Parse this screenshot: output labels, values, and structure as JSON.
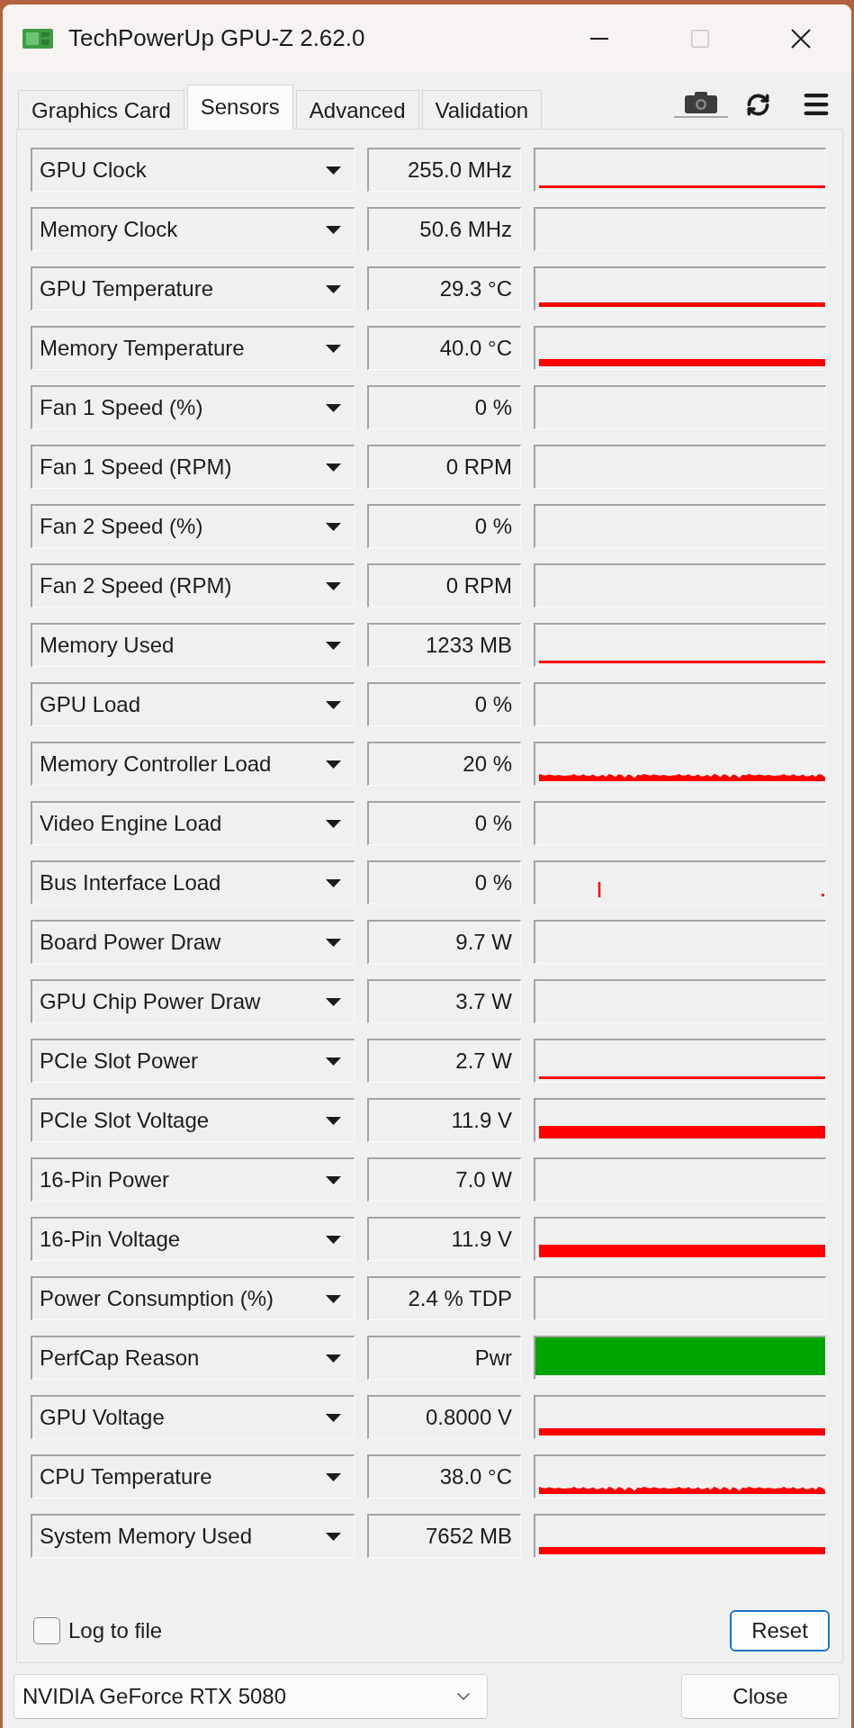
{
  "window": {
    "title": "TechPowerUp GPU-Z 2.62.0",
    "maximize_disabled": true
  },
  "tabs": [
    {
      "label": "Graphics Card",
      "selected": false
    },
    {
      "label": "Sensors",
      "selected": true
    },
    {
      "label": "Advanced",
      "selected": false
    },
    {
      "label": "Validation",
      "selected": false
    }
  ],
  "sensors": [
    {
      "name": "GPU Clock",
      "value": "255.0 MHz",
      "kind": "thin"
    },
    {
      "name": "Memory Clock",
      "value": "50.6 MHz",
      "kind": "none"
    },
    {
      "name": "GPU Temperature",
      "value": "29.3 °C",
      "kind": "line"
    },
    {
      "name": "Memory Temperature",
      "value": "40.0 °C",
      "kind": "thick"
    },
    {
      "name": "Fan 1 Speed (%)",
      "value": "0 %",
      "kind": "none"
    },
    {
      "name": "Fan 1 Speed (RPM)",
      "value": "0 RPM",
      "kind": "none"
    },
    {
      "name": "Fan 2 Speed (%)",
      "value": "0 %",
      "kind": "none"
    },
    {
      "name": "Fan 2 Speed (RPM)",
      "value": "0 RPM",
      "kind": "none"
    },
    {
      "name": "Memory Used",
      "value": "1233 MB",
      "kind": "thin"
    },
    {
      "name": "GPU Load",
      "value": "0 %",
      "kind": "none"
    },
    {
      "name": "Memory Controller Load",
      "value": "20 %",
      "kind": "noise"
    },
    {
      "name": "Video Engine Load",
      "value": "0 %",
      "kind": "none"
    },
    {
      "name": "Bus Interface Load",
      "value": "0 %",
      "kind": "spike"
    },
    {
      "name": "Board Power Draw",
      "value": "9.7 W",
      "kind": "none"
    },
    {
      "name": "GPU Chip Power Draw",
      "value": "3.7 W",
      "kind": "none"
    },
    {
      "name": "PCIe Slot Power",
      "value": "2.7 W",
      "kind": "thin"
    },
    {
      "name": "PCIe Slot Voltage",
      "value": "11.9 V",
      "kind": "heavy"
    },
    {
      "name": "16-Pin Power",
      "value": "7.0 W",
      "kind": "none"
    },
    {
      "name": "16-Pin Voltage",
      "value": "11.9 V",
      "kind": "heavy"
    },
    {
      "name": "Power Consumption (%)",
      "value": "2.4 % TDP",
      "kind": "none"
    },
    {
      "name": "PerfCap Reason",
      "value": "Pwr",
      "kind": "fill"
    },
    {
      "name": "GPU Voltage",
      "value": "0.8000 V",
      "kind": "thick"
    },
    {
      "name": "CPU Temperature",
      "value": "38.0 °C",
      "kind": "noise"
    },
    {
      "name": "System Memory Used",
      "value": "7652 MB",
      "kind": "thick"
    }
  ],
  "log_to_file": {
    "label": "Log to file",
    "checked": false
  },
  "reset_button": {
    "label": "Reset",
    "focused": true
  },
  "gpu_select": {
    "value": "NVIDIA GeForce RTX 5080"
  },
  "close_button": {
    "label": "Close"
  }
}
